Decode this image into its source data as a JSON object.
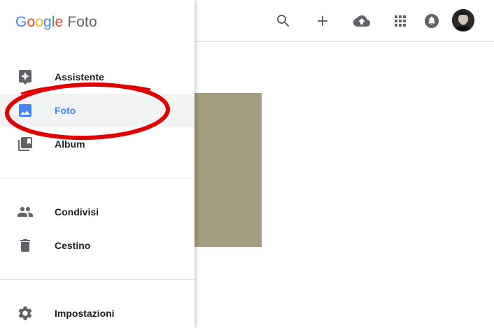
{
  "brand": {
    "google_letters": [
      {
        "char": "G",
        "color": "#4285F4"
      },
      {
        "char": "o",
        "color": "#EA4335"
      },
      {
        "char": "o",
        "color": "#FBBC05"
      },
      {
        "char": "g",
        "color": "#4285F4"
      },
      {
        "char": "l",
        "color": "#34A853"
      },
      {
        "char": "e",
        "color": "#EA4335"
      }
    ],
    "app_name": "Foto"
  },
  "topbar": {
    "icons": [
      "search-icon",
      "add-icon",
      "upload-cloud-icon",
      "apps-grid-icon",
      "notifications-icon"
    ]
  },
  "drawer": {
    "items": [
      {
        "label": "Assistente",
        "icon": "assistant-icon",
        "active": false
      },
      {
        "label": "Foto",
        "icon": "photo-icon",
        "active": true
      },
      {
        "label": "Album",
        "icon": "album-icon",
        "active": false
      },
      {
        "label": "Condivisi",
        "icon": "shared-people-icon",
        "active": false
      },
      {
        "label": "Cestino",
        "icon": "trash-icon",
        "active": false
      },
      {
        "label": "Impostazioni",
        "icon": "settings-gear-icon",
        "active": false
      }
    ]
  },
  "colors": {
    "accent": "#4285F4",
    "active_bg": "#F1F3F4",
    "annotation": "#E00000",
    "photo_placeholder": "#A39C7F"
  }
}
